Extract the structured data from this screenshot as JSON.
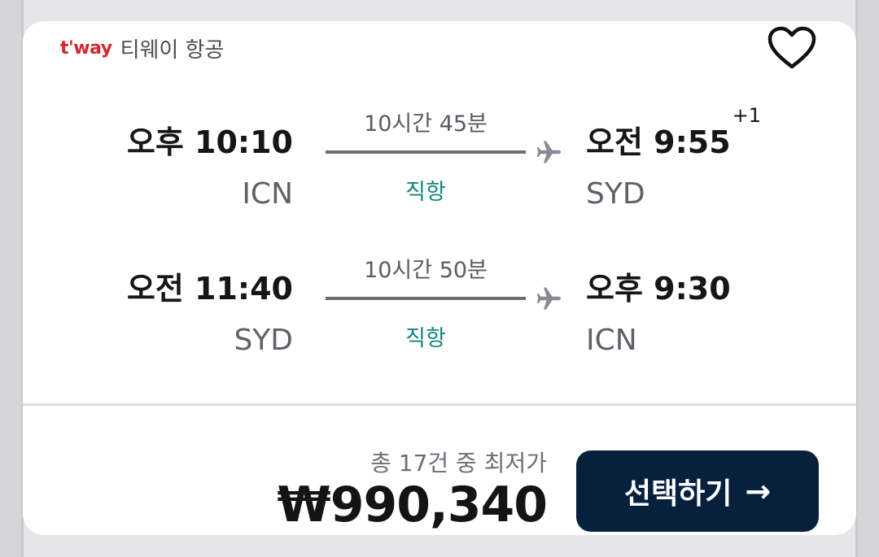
{
  "airline": {
    "logo_text": "t'way",
    "name": "티웨이 항공",
    "logo_color": "#d6262f"
  },
  "favorite": {
    "icon": "heart-outline-icon"
  },
  "outbound": {
    "depart_time": "오후 10:10",
    "depart_code": "ICN",
    "duration": "10시간 45분",
    "stops": "직항",
    "arrive_time": "오전 9:55",
    "arrive_day_offset": "+1",
    "arrive_code": "SYD"
  },
  "inbound": {
    "depart_time": "오전 11:40",
    "depart_code": "SYD",
    "duration": "10시간 50분",
    "stops": "직항",
    "arrive_time": "오후 9:30",
    "arrive_code": "ICN"
  },
  "price": {
    "note": "총 17건 중 최저가",
    "amount": "₩990,340"
  },
  "select_button": {
    "label": "선택하기",
    "arrow": "→",
    "color": "#07213d"
  },
  "colors": {
    "direct_flight": "#13857a"
  }
}
